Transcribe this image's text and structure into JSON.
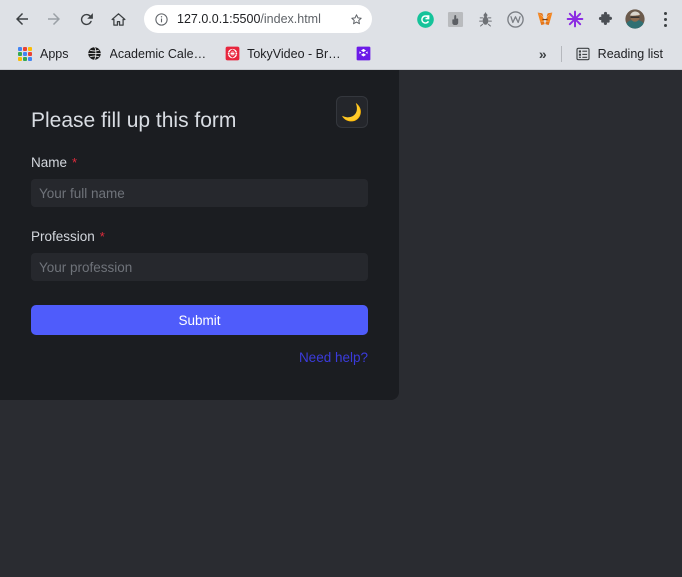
{
  "browser": {
    "nav": {
      "back_icon": "back-arrow-icon",
      "forward_icon": "forward-arrow-icon",
      "reload_icon": "reload-icon",
      "home_icon": "home-icon"
    },
    "omnibox": {
      "info_icon": "site-info-icon",
      "url_host": "127.0.0.1:5500",
      "url_path": "/index.html",
      "url_full": "127.0.0.1:5500/index.html",
      "bookmark_icon": "star-icon"
    },
    "extensions": [
      {
        "name": "grammarly-extension-icon",
        "label": "G"
      },
      {
        "name": "cursor-extension-icon",
        "label": ""
      },
      {
        "name": "bug-extension-icon",
        "label": ""
      },
      {
        "name": "w-circle-extension-icon",
        "label": "W"
      },
      {
        "name": "metamask-extension-icon",
        "label": ""
      },
      {
        "name": "purple-asterisk-extension-icon",
        "label": ""
      },
      {
        "name": "extensions-puzzle-icon",
        "label": ""
      },
      {
        "name": "profile-avatar",
        "label": ""
      }
    ],
    "menu_icon": "three-dot-menu-icon",
    "bookmarks": {
      "apps": {
        "label": "Apps",
        "icon": "apps-grid-icon"
      },
      "items": [
        {
          "label": "Academic Cale…",
          "icon": "globe-favicon"
        },
        {
          "label": "TokyVideo - Br…",
          "icon": "tokyvideo-favicon"
        },
        {
          "label": "",
          "icon": "purple-favicon"
        }
      ],
      "overflow_label": "»",
      "reading_list": {
        "label": "Reading list",
        "icon": "reading-list-icon"
      }
    }
  },
  "page": {
    "title": "Please fill up this form",
    "theme_toggle": {
      "icon": "moon-icon",
      "glyph": "🌙"
    },
    "fields": [
      {
        "label": "Name",
        "required_marker": "*",
        "placeholder": "Your full name",
        "value": "",
        "name": "name-input"
      },
      {
        "label": "Profession",
        "required_marker": "*",
        "placeholder": "Your profession",
        "value": "",
        "name": "profession-input"
      }
    ],
    "submit_label": "Submit",
    "help_link_label": "Need help?",
    "colors": {
      "page_background": "#2a2c31",
      "card_background": "#1b1d21",
      "input_background": "#26282d",
      "submit_button": "#4f5cfb",
      "link": "#3b3bdc",
      "required_asterisk": "#e02b3c",
      "moon_icon": "#d7d12c",
      "heading_text": "#d9dde3"
    }
  }
}
